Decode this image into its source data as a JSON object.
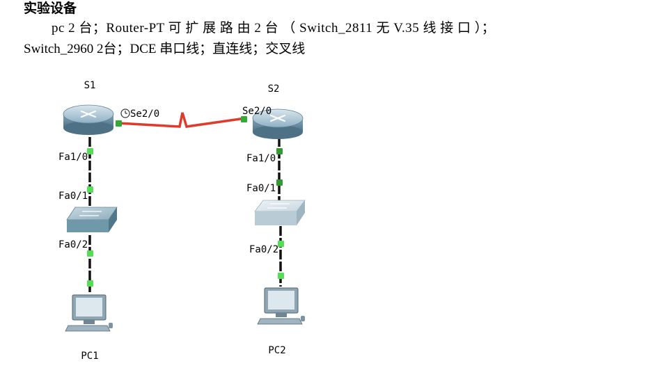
{
  "doc": {
    "heading": "实验设备",
    "line1": "pc 2 台；Router-PT 可 扩 展 路 由  2 台 （ Switch_2811 无 V.35 线 接 口 ）；",
    "line2": "Switch_2960 2台；DCE 串口线；直连线；交叉线"
  },
  "topology": {
    "devices": {
      "r1": "S1",
      "r2": "S2",
      "pc1": "PC1",
      "pc2": "PC2"
    },
    "ports": {
      "r1_serial": "Se2/0",
      "r2_serial": "Se2/0",
      "r1_fa": "Fa1/0",
      "sw1_up": "Fa0/1",
      "sw1_down": "Fa0/2",
      "r2_fa": "Fa1/0",
      "sw2_up": "Fa0/1",
      "sw2_down": "Fa0/2"
    },
    "colors": {
      "serial_link": "#e03a2a",
      "ethernet_link": "#111111",
      "link_up": "#33cc33",
      "router_body": "#7fa6bf",
      "switch_body": "#6f98a8",
      "switch2_body": "#b9ccd6"
    }
  }
}
